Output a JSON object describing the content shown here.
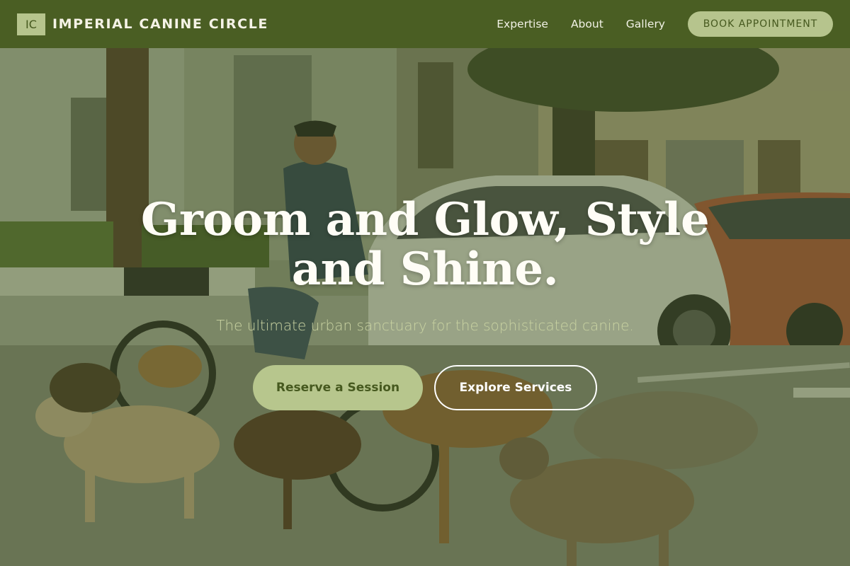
{
  "brand": {
    "logo_initials": "IC",
    "name": "IMPERIAL CANINE CIRCLE"
  },
  "nav": {
    "links": [
      "Expertise",
      "About",
      "Gallery"
    ],
    "cta_label": "BOOK APPOINTMENT"
  },
  "hero": {
    "headline_line1": "Groom and Glow, Style",
    "headline_line2": "and Shine.",
    "subheadline": "The ultimate urban sanctuary for the sophisticated canine.",
    "primary_button": "Reserve a Session",
    "secondary_button": "Explore Services",
    "image_description": "street-scene-man-walking-dogs-photo"
  },
  "colors": {
    "nav_bg": "#4a5e23",
    "accent": "#b6c48d",
    "accent_text": "#46591f",
    "headline": "#fffdf6",
    "subheadline": "#c9d3a2"
  }
}
